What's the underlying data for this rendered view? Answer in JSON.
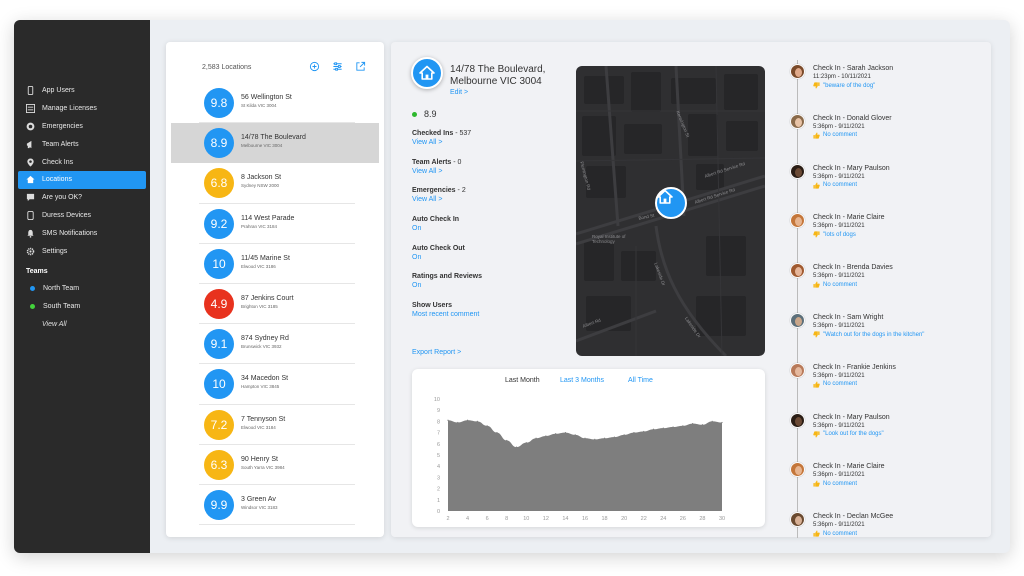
{
  "colors": {
    "accent": "#2196f3",
    "sidebar": "#2a2a2a",
    "score_blue": "#2196f3",
    "score_yellow": "#f7b614",
    "score_red": "#e8321e",
    "team_north": "#2196f3",
    "team_south": "#43d33c",
    "chart_fill": "#7e7e7e"
  },
  "sidebar": {
    "items": [
      {
        "label": "App Users",
        "icon": "phone-icon"
      },
      {
        "label": "Manage Licenses",
        "icon": "license-icon"
      },
      {
        "label": "Emergencies",
        "icon": "siren-icon"
      },
      {
        "label": "Team Alerts",
        "icon": "megaphone-icon"
      },
      {
        "label": "Check Ins",
        "icon": "pin-icon"
      },
      {
        "label": "Locations",
        "icon": "home-icon",
        "active": true
      },
      {
        "label": "Are you OK?",
        "icon": "chat-icon"
      },
      {
        "label": "Duress Devices",
        "icon": "device-icon"
      },
      {
        "label": "SMS Notifications",
        "icon": "bell-icon"
      },
      {
        "label": "Settings",
        "icon": "gear-icon"
      }
    ],
    "teams_heading": "Teams",
    "teams": [
      {
        "label": "North Team",
        "color": "#2196f3"
      },
      {
        "label": "South Team",
        "color": "#43d33c"
      }
    ],
    "view_all": "View All"
  },
  "locations": {
    "count_label": "2,583 Locations",
    "tool_icons": [
      "add-icon",
      "filter-icon",
      "export-icon"
    ],
    "items": [
      {
        "score": "9.8",
        "color": "#2196f3",
        "name": "56 Wellington St",
        "suburb": "St Kilda VIC 3004"
      },
      {
        "score": "8.9",
        "color": "#2196f3",
        "name": "14/78 The Boulevard",
        "suburb": "Melbourne VIC 3004",
        "active": true
      },
      {
        "score": "6.8",
        "color": "#f7b614",
        "name": "8 Jackson St",
        "suburb": "Sydney NSW 2000"
      },
      {
        "score": "9.2",
        "color": "#2196f3",
        "name": "114 West Parade",
        "suburb": "Prahran VIC 3184"
      },
      {
        "score": "10",
        "color": "#2196f3",
        "name": "11/45 Marine St",
        "suburb": "Elwood VIC 3186"
      },
      {
        "score": "4.9",
        "color": "#e8321e",
        "name": "87 Jenkins Court",
        "suburb": "Brighton VIC 3185"
      },
      {
        "score": "9.1",
        "color": "#2196f3",
        "name": "874 Sydney Rd",
        "suburb": "Brunswick VIC 3932"
      },
      {
        "score": "10",
        "color": "#2196f3",
        "name": "34 Macedon St",
        "suburb": "Hampton VIC 3845"
      },
      {
        "score": "7.2",
        "color": "#f7b614",
        "name": "7 Tennyson St",
        "suburb": "Elwood VIC 3184"
      },
      {
        "score": "6.3",
        "color": "#f7b614",
        "name": "90 Henry St",
        "suburb": "South Yarra VIC 3984"
      },
      {
        "score": "9.9",
        "color": "#2196f3",
        "name": "3 Green Av",
        "suburb": "Windsor VIC 3183"
      }
    ]
  },
  "detail": {
    "address_line1": "14/78 The Boulevard,",
    "address_line2": "Melbourne VIC 3004",
    "edit": "Edit >",
    "rating": "8.9",
    "stats": [
      {
        "label": "Checked Ins",
        "count": " - 537",
        "link": "View All >"
      },
      {
        "label": "Team Alerts",
        "count": " - 0",
        "link": "View All >"
      },
      {
        "label": "Emergencies",
        "count": " - 2",
        "link": "View All >"
      },
      {
        "label": "Auto Check In",
        "count": "",
        "link": "On"
      },
      {
        "label": "Auto Check Out",
        "count": "",
        "link": "On"
      },
      {
        "label": "Ratings and Reviews",
        "count": "",
        "link": "On"
      },
      {
        "label": "Show Users",
        "count": "",
        "link": "Most recent comment"
      }
    ],
    "export": "Export Report >",
    "map_streets": [
      "Kensington St",
      "Bond St",
      "Flemington Rd",
      "Royal Institute of Technology",
      "Albert Rd Service Rd",
      "Albert Rd Service Rd",
      "Lakeside Dr",
      "Lakeside Dr",
      "Albert Rd"
    ]
  },
  "chart_tabs": [
    {
      "label": "Last Month",
      "selected": true
    },
    {
      "label": "Last 3 Months",
      "selected": false
    },
    {
      "label": "All Time",
      "selected": false
    }
  ],
  "chart_data": {
    "type": "area",
    "x": [
      2,
      3,
      4,
      5,
      6,
      7,
      8,
      9,
      10,
      11,
      12,
      13,
      14,
      15,
      16,
      17,
      18,
      19,
      20,
      21,
      22,
      23,
      24,
      25,
      26,
      27,
      28,
      29,
      30
    ],
    "values": [
      8.1,
      7.9,
      8.1,
      8.0,
      7.6,
      7.0,
      6.3,
      5.7,
      6.1,
      6.5,
      6.7,
      6.9,
      7.0,
      6.8,
      6.5,
      6.4,
      6.5,
      6.6,
      6.8,
      7.0,
      7.1,
      7.3,
      7.4,
      7.5,
      7.6,
      7.8,
      7.7,
      8.0,
      7.9
    ],
    "xticks": [
      2,
      4,
      6,
      8,
      10,
      12,
      14,
      16,
      18,
      20,
      22,
      24,
      26,
      28,
      30
    ],
    "yticks": [
      0,
      1,
      2,
      3,
      4,
      5,
      6,
      7,
      8,
      9,
      10
    ],
    "ylim": [
      0,
      10
    ],
    "xlim": [
      2,
      30
    ],
    "grid": false,
    "legend": "none"
  },
  "checkins": [
    {
      "title": "Check In - Sarah Jackson",
      "time": "11:23pm - 10/11/2021",
      "comment": "\"beware of the dog\"",
      "thumb": "down",
      "skin": "#e0a98a",
      "hair": "#7a4a2a"
    },
    {
      "title": "Check In - Donald Glover",
      "time": "5:36pm - 9/11/2021",
      "comment": "No comment",
      "thumb": "up",
      "skin": "#e8c3a6",
      "hair": "#8a6a4a"
    },
    {
      "title": "Check In - Mary Paulson",
      "time": "5:36pm - 9/11/2021",
      "comment": "No comment",
      "thumb": "up",
      "skin": "#6b4a35",
      "hair": "#2a1d15"
    },
    {
      "title": "Check In - Marie Claire",
      "time": "5:36pm - 9/11/2021",
      "comment": "\"lots of dogs",
      "thumb": "down",
      "skin": "#e7b48f",
      "hair": "#c4763a"
    },
    {
      "title": "Check In - Brenda Davies",
      "time": "5:36pm - 9/11/2021",
      "comment": "No comment",
      "thumb": "up",
      "skin": "#e6b69a",
      "hair": "#a05a30"
    },
    {
      "title": "Check In - Sam Wright",
      "time": "5:36pm - 9/11/2021",
      "comment": "\"Watch out for the dogs in the kitchen\"",
      "thumb": "down",
      "skin": "#c9a68a",
      "hair": "#5c6f7a"
    },
    {
      "title": "Check In - Frankie Jenkins",
      "time": "5:36pm - 9/11/2021",
      "comment": "No comment",
      "thumb": "up",
      "skin": "#e5b99f",
      "hair": "#b87a5a"
    },
    {
      "title": "Check In - Mary Paulson",
      "time": "5:36pm - 9/11/2021",
      "comment": "\"Look out for the dogs\"",
      "thumb": "down",
      "skin": "#6b4a35",
      "hair": "#2a1d15"
    },
    {
      "title": "Check In - Marie Claire",
      "time": "5:36pm - 9/11/2021",
      "comment": "No comment",
      "thumb": "up",
      "skin": "#e7b48f",
      "hair": "#c4763a"
    },
    {
      "title": "Check In - Declan McGee",
      "time": "5:36pm - 9/11/2021",
      "comment": "No comment",
      "thumb": "up",
      "skin": "#d8b095",
      "hair": "#6a4a30"
    }
  ]
}
